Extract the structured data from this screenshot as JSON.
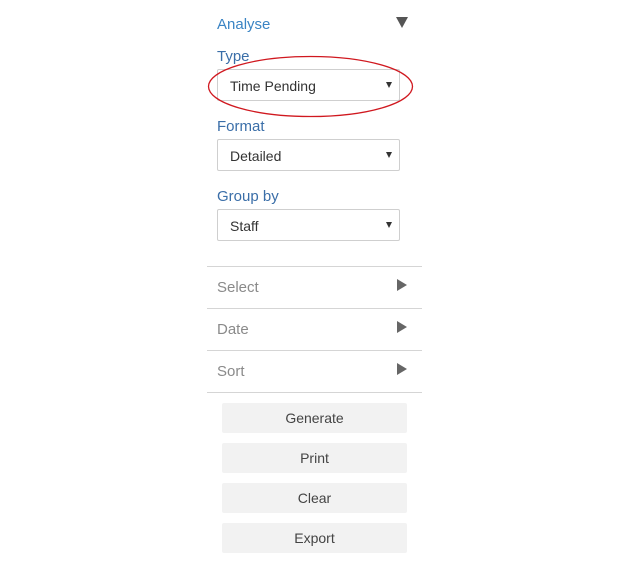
{
  "analyse": {
    "title": "Analyse",
    "expanded_icon": "triangle-down-icon",
    "type": {
      "label": "Type",
      "value": "Time Pending"
    },
    "format": {
      "label": "Format",
      "value": "Detailed"
    },
    "group_by": {
      "label": "Group by",
      "value": "Staff"
    }
  },
  "sections": {
    "select": {
      "label": "Select"
    },
    "date": {
      "label": "Date"
    },
    "sort": {
      "label": "Sort"
    }
  },
  "buttons": {
    "generate": "Generate",
    "print": "Print",
    "clear": "Clear",
    "export": "Export"
  },
  "annotation": {
    "color": "#d0181f",
    "icon": "red-ellipse-highlight"
  }
}
